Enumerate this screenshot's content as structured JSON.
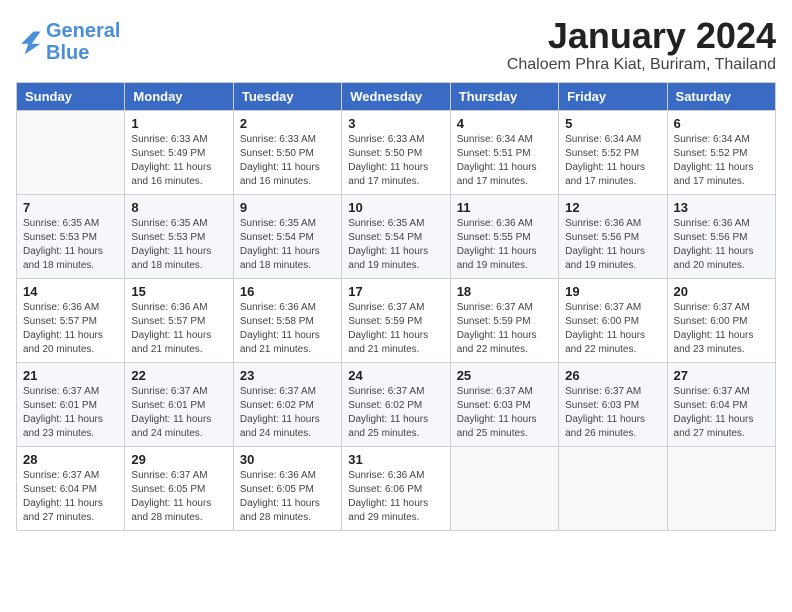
{
  "logo": {
    "line1": "General",
    "line2": "Blue"
  },
  "title": "January 2024",
  "subtitle": "Chaloem Phra Kiat, Buriram, Thailand",
  "header": {
    "days": [
      "Sunday",
      "Monday",
      "Tuesday",
      "Wednesday",
      "Thursday",
      "Friday",
      "Saturday"
    ]
  },
  "weeks": [
    [
      {
        "day": "",
        "sunrise": "",
        "sunset": "",
        "daylight": ""
      },
      {
        "day": "1",
        "sunrise": "Sunrise: 6:33 AM",
        "sunset": "Sunset: 5:49 PM",
        "daylight": "Daylight: 11 hours and 16 minutes."
      },
      {
        "day": "2",
        "sunrise": "Sunrise: 6:33 AM",
        "sunset": "Sunset: 5:50 PM",
        "daylight": "Daylight: 11 hours and 16 minutes."
      },
      {
        "day": "3",
        "sunrise": "Sunrise: 6:33 AM",
        "sunset": "Sunset: 5:50 PM",
        "daylight": "Daylight: 11 hours and 17 minutes."
      },
      {
        "day": "4",
        "sunrise": "Sunrise: 6:34 AM",
        "sunset": "Sunset: 5:51 PM",
        "daylight": "Daylight: 11 hours and 17 minutes."
      },
      {
        "day": "5",
        "sunrise": "Sunrise: 6:34 AM",
        "sunset": "Sunset: 5:52 PM",
        "daylight": "Daylight: 11 hours and 17 minutes."
      },
      {
        "day": "6",
        "sunrise": "Sunrise: 6:34 AM",
        "sunset": "Sunset: 5:52 PM",
        "daylight": "Daylight: 11 hours and 17 minutes."
      }
    ],
    [
      {
        "day": "7",
        "sunrise": "Sunrise: 6:35 AM",
        "sunset": "Sunset: 5:53 PM",
        "daylight": "Daylight: 11 hours and 18 minutes."
      },
      {
        "day": "8",
        "sunrise": "Sunrise: 6:35 AM",
        "sunset": "Sunset: 5:53 PM",
        "daylight": "Daylight: 11 hours and 18 minutes."
      },
      {
        "day": "9",
        "sunrise": "Sunrise: 6:35 AM",
        "sunset": "Sunset: 5:54 PM",
        "daylight": "Daylight: 11 hours and 18 minutes."
      },
      {
        "day": "10",
        "sunrise": "Sunrise: 6:35 AM",
        "sunset": "Sunset: 5:54 PM",
        "daylight": "Daylight: 11 hours and 19 minutes."
      },
      {
        "day": "11",
        "sunrise": "Sunrise: 6:36 AM",
        "sunset": "Sunset: 5:55 PM",
        "daylight": "Daylight: 11 hours and 19 minutes."
      },
      {
        "day": "12",
        "sunrise": "Sunrise: 6:36 AM",
        "sunset": "Sunset: 5:56 PM",
        "daylight": "Daylight: 11 hours and 19 minutes."
      },
      {
        "day": "13",
        "sunrise": "Sunrise: 6:36 AM",
        "sunset": "Sunset: 5:56 PM",
        "daylight": "Daylight: 11 hours and 20 minutes."
      }
    ],
    [
      {
        "day": "14",
        "sunrise": "Sunrise: 6:36 AM",
        "sunset": "Sunset: 5:57 PM",
        "daylight": "Daylight: 11 hours and 20 minutes."
      },
      {
        "day": "15",
        "sunrise": "Sunrise: 6:36 AM",
        "sunset": "Sunset: 5:57 PM",
        "daylight": "Daylight: 11 hours and 21 minutes."
      },
      {
        "day": "16",
        "sunrise": "Sunrise: 6:36 AM",
        "sunset": "Sunset: 5:58 PM",
        "daylight": "Daylight: 11 hours and 21 minutes."
      },
      {
        "day": "17",
        "sunrise": "Sunrise: 6:37 AM",
        "sunset": "Sunset: 5:59 PM",
        "daylight": "Daylight: 11 hours and 21 minutes."
      },
      {
        "day": "18",
        "sunrise": "Sunrise: 6:37 AM",
        "sunset": "Sunset: 5:59 PM",
        "daylight": "Daylight: 11 hours and 22 minutes."
      },
      {
        "day": "19",
        "sunrise": "Sunrise: 6:37 AM",
        "sunset": "Sunset: 6:00 PM",
        "daylight": "Daylight: 11 hours and 22 minutes."
      },
      {
        "day": "20",
        "sunrise": "Sunrise: 6:37 AM",
        "sunset": "Sunset: 6:00 PM",
        "daylight": "Daylight: 11 hours and 23 minutes."
      }
    ],
    [
      {
        "day": "21",
        "sunrise": "Sunrise: 6:37 AM",
        "sunset": "Sunset: 6:01 PM",
        "daylight": "Daylight: 11 hours and 23 minutes."
      },
      {
        "day": "22",
        "sunrise": "Sunrise: 6:37 AM",
        "sunset": "Sunset: 6:01 PM",
        "daylight": "Daylight: 11 hours and 24 minutes."
      },
      {
        "day": "23",
        "sunrise": "Sunrise: 6:37 AM",
        "sunset": "Sunset: 6:02 PM",
        "daylight": "Daylight: 11 hours and 24 minutes."
      },
      {
        "day": "24",
        "sunrise": "Sunrise: 6:37 AM",
        "sunset": "Sunset: 6:02 PM",
        "daylight": "Daylight: 11 hours and 25 minutes."
      },
      {
        "day": "25",
        "sunrise": "Sunrise: 6:37 AM",
        "sunset": "Sunset: 6:03 PM",
        "daylight": "Daylight: 11 hours and 25 minutes."
      },
      {
        "day": "26",
        "sunrise": "Sunrise: 6:37 AM",
        "sunset": "Sunset: 6:03 PM",
        "daylight": "Daylight: 11 hours and 26 minutes."
      },
      {
        "day": "27",
        "sunrise": "Sunrise: 6:37 AM",
        "sunset": "Sunset: 6:04 PM",
        "daylight": "Daylight: 11 hours and 27 minutes."
      }
    ],
    [
      {
        "day": "28",
        "sunrise": "Sunrise: 6:37 AM",
        "sunset": "Sunset: 6:04 PM",
        "daylight": "Daylight: 11 hours and 27 minutes."
      },
      {
        "day": "29",
        "sunrise": "Sunrise: 6:37 AM",
        "sunset": "Sunset: 6:05 PM",
        "daylight": "Daylight: 11 hours and 28 minutes."
      },
      {
        "day": "30",
        "sunrise": "Sunrise: 6:36 AM",
        "sunset": "Sunset: 6:05 PM",
        "daylight": "Daylight: 11 hours and 28 minutes."
      },
      {
        "day": "31",
        "sunrise": "Sunrise: 6:36 AM",
        "sunset": "Sunset: 6:06 PM",
        "daylight": "Daylight: 11 hours and 29 minutes."
      },
      {
        "day": "",
        "sunrise": "",
        "sunset": "",
        "daylight": ""
      },
      {
        "day": "",
        "sunrise": "",
        "sunset": "",
        "daylight": ""
      },
      {
        "day": "",
        "sunrise": "",
        "sunset": "",
        "daylight": ""
      }
    ]
  ]
}
